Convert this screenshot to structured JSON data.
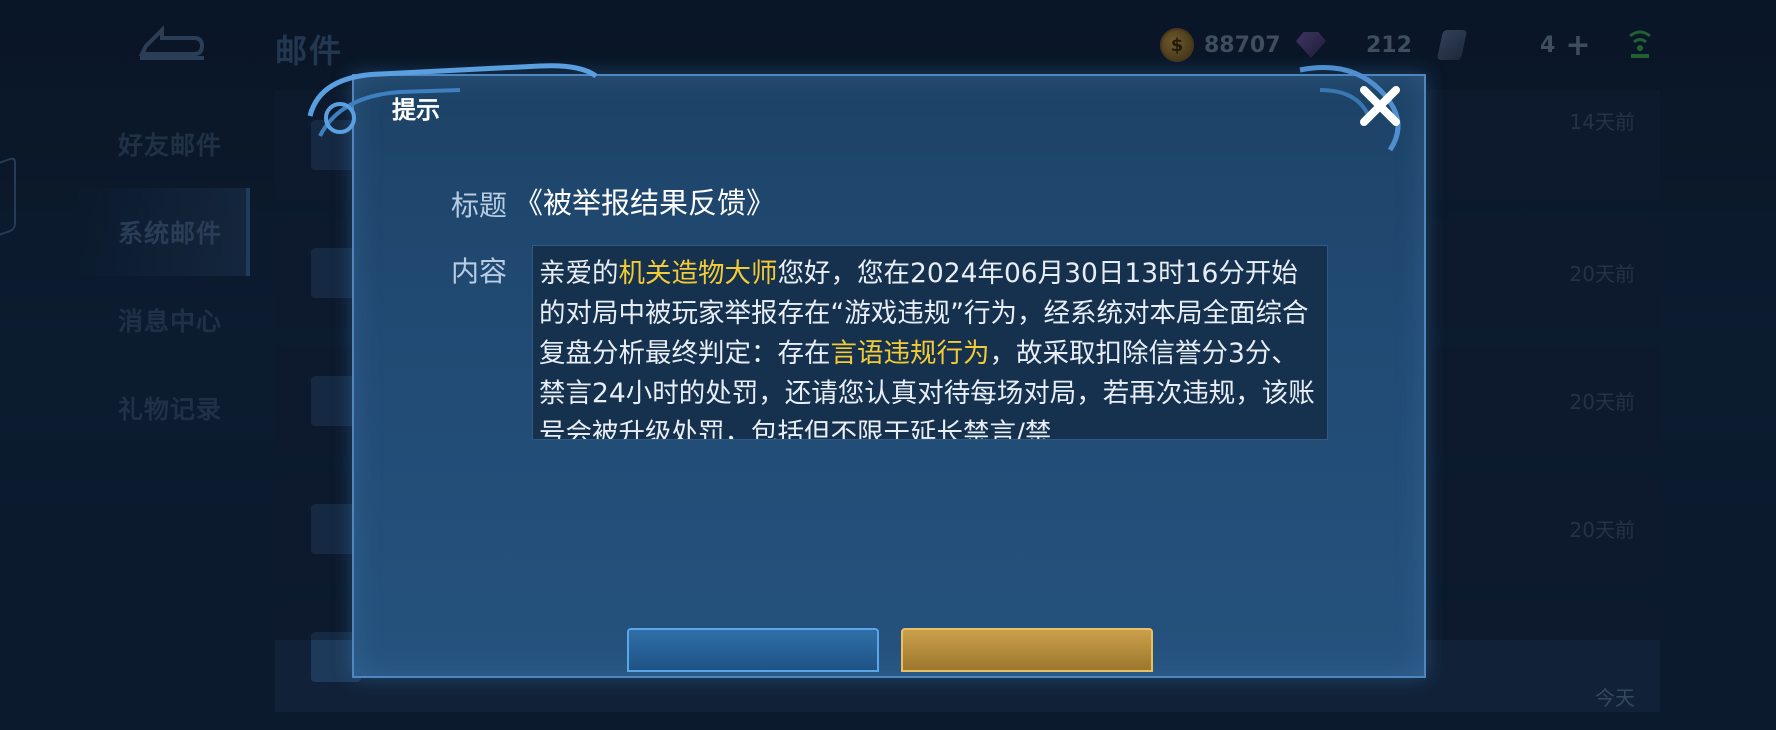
{
  "header": {
    "title": "邮件",
    "gold": "88707",
    "gems": "212",
    "tickets": "4"
  },
  "sidebar": {
    "items": [
      {
        "label": "好友邮件"
      },
      {
        "label": "系统邮件"
      },
      {
        "label": "消息中心"
      },
      {
        "label": "礼物记录"
      }
    ]
  },
  "mail_list": {
    "rows": [
      {
        "time": "14天前"
      },
      {
        "time": "20天前"
      },
      {
        "time": "20天前"
      },
      {
        "time": "20天前"
      },
      {
        "time": "今天"
      }
    ]
  },
  "dialog": {
    "title": "提示",
    "subject_label": "标题",
    "subject": "《被举报结果反馈》",
    "content_label": "内容",
    "content_parts": {
      "p1": "亲爱的",
      "name": "机关造物大师",
      "p2": "您好，您在2024年06月30日13时16分开始的对局中被玩家举报存在“游戏违规”行为，经系统对本局全面综合复盘分析最终判定：存在",
      "violation": "言语违规行为",
      "p3": "，故采取扣除信誉分3分、禁言24小时的处罚，还请您认真对待每场对局，若再次违规，该账号会被升级处罚，包括但不限于延长禁言/禁"
    }
  },
  "colors": {
    "highlight": "#f2cb36",
    "dialog_border": "#4f86bd",
    "dialog_bg": "#214a73"
  }
}
